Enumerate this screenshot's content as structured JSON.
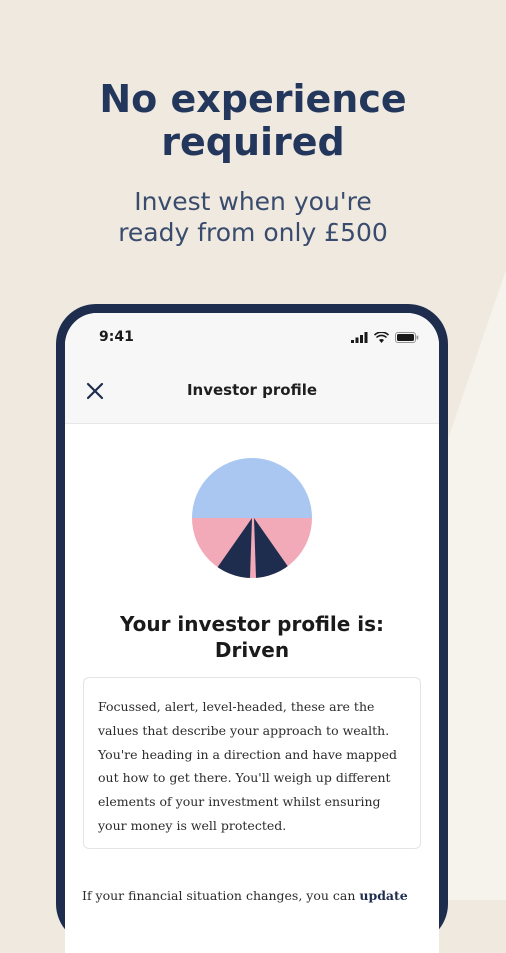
{
  "marketing": {
    "headline_line1": "No experience",
    "headline_line2": "required",
    "subline_line1": "Invest when you're",
    "subline_line2": "ready from only £500"
  },
  "status_bar": {
    "time": "9:41"
  },
  "app_bar": {
    "title": "Investor profile",
    "close_icon": "close-icon"
  },
  "profile": {
    "heading": "Your investor profile is:",
    "type": "Driven",
    "colors": {
      "sky": "#a9c7f1",
      "band": "#f2aab9",
      "peak": "#1e2d4d"
    },
    "description": "Focussed, alert, level-headed, these are the values that describe your approach to wealth. You're heading in a direction and have mapped out how to get there. You'll weigh up different elements of your investment whilst ensuring your money is well protected."
  },
  "footer": {
    "text": "If your financial situation changes, you can ",
    "link": "update"
  },
  "colors": {
    "background": "#efe9df",
    "accent_shape": "#f6f3ec",
    "navy": "#1e2d4d",
    "headline": "#23375c"
  }
}
